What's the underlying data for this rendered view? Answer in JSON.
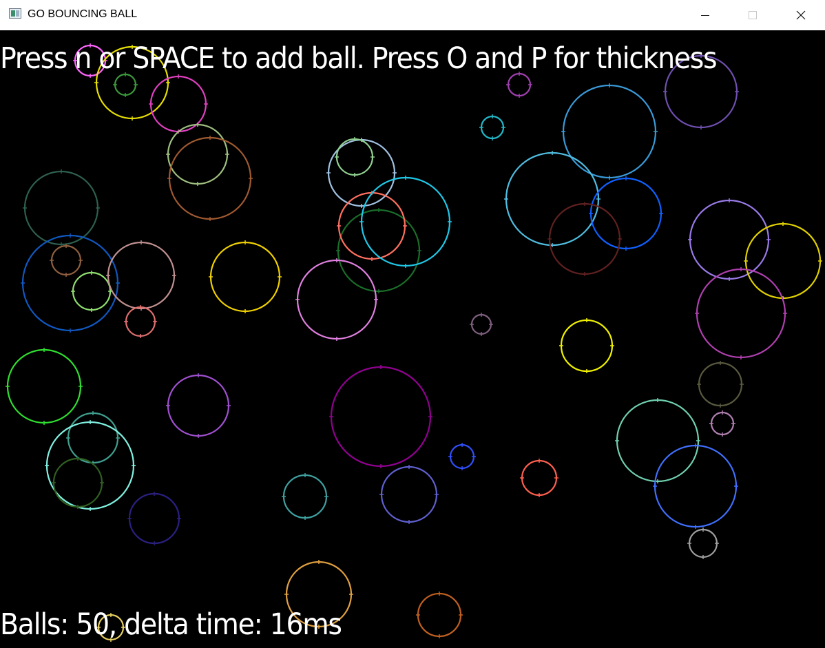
{
  "window": {
    "title": "GO BOUNCING BALL",
    "icon": "app-window-icon",
    "controls": [
      "minimize-icon",
      "maximize-icon",
      "close-icon"
    ]
  },
  "hud": {
    "instructions": "Press n or SPACE to add ball. Press O and P for thickness",
    "stats": "Balls: 50, delta time: 16ms"
  },
  "colors": {
    "background": "#000000",
    "text": "#ffffff"
  },
  "balls": [
    {
      "color": "#ff66ff"
    },
    {
      "color": "#e8e000"
    },
    {
      "color": "#3c9a3c"
    },
    {
      "color": "#e040c0"
    },
    {
      "color": "#a0c080"
    },
    {
      "color": "#a05a30"
    },
    {
      "color": "#a040b0"
    },
    {
      "color": "#22b8c8"
    },
    {
      "color": "#7050b0"
    },
    {
      "color": "#3a9ad8"
    },
    {
      "color": "#a0c0e0"
    },
    {
      "color": "#90d090"
    },
    {
      "color": "#2e6050"
    },
    {
      "color": "#50bde0"
    },
    {
      "color": "#1060ff"
    },
    {
      "color": "#602020"
    },
    {
      "color": "#9a7ae8"
    },
    {
      "color": "#e0d000"
    },
    {
      "color": "#b040b0"
    },
    {
      "color": "#1a6e2a"
    },
    {
      "color": "#ff7060"
    },
    {
      "color": "#20c8e8"
    },
    {
      "color": "#1058c0"
    },
    {
      "color": "#906040"
    },
    {
      "color": "#90e070"
    },
    {
      "color": "#c09090"
    },
    {
      "color": "#e07070"
    },
    {
      "color": "#f0d000"
    },
    {
      "color": "#e080e0"
    },
    {
      "color": "#806080"
    },
    {
      "color": "#f0f000"
    },
    {
      "color": "#30e030"
    },
    {
      "color": "#a050d0"
    },
    {
      "color": "#900090"
    },
    {
      "color": "#5a5a40"
    },
    {
      "color": "#b080b0"
    },
    {
      "color": "#40a090"
    },
    {
      "color": "#80f0e0"
    },
    {
      "color": "#3050ff"
    },
    {
      "color": "#306020"
    },
    {
      "color": "#70d0b0"
    },
    {
      "color": "#4070ff"
    },
    {
      "color": "#ff6050"
    },
    {
      "color": "#2a2080"
    },
    {
      "color": "#40a0a0"
    },
    {
      "color": "#6060d0"
    },
    {
      "color": "#a0a0a0"
    },
    {
      "color": "#e0a040"
    },
    {
      "color": "#c06020"
    },
    {
      "color": "#e8d060"
    }
  ]
}
